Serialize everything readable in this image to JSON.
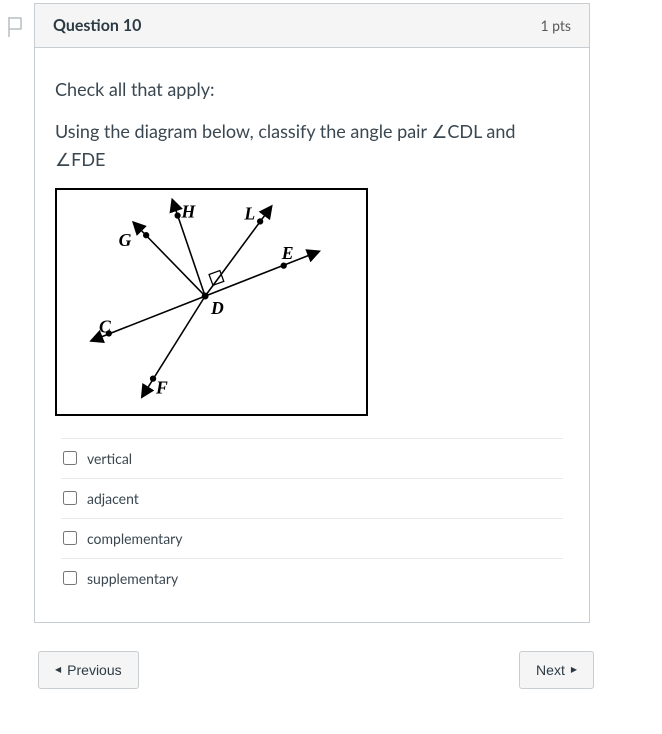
{
  "header": {
    "title": "Question 10",
    "points": "1 pts"
  },
  "prompt": {
    "line1": "Check all that apply:",
    "line2_prefix": "Using the diagram below, classify the angle pair ",
    "angle1": "∠CDL",
    "and": " and ",
    "angle2": "∠FDE"
  },
  "diagram": {
    "points": {
      "G": "G",
      "H": "H",
      "L": "L",
      "E": "E",
      "D": "D",
      "C": "C",
      "F": "F"
    }
  },
  "options": [
    {
      "label": "vertical"
    },
    {
      "label": "adjacent"
    },
    {
      "label": "complementary"
    },
    {
      "label": "supplementary"
    }
  ],
  "nav": {
    "previous": "Previous",
    "next": "Next"
  }
}
